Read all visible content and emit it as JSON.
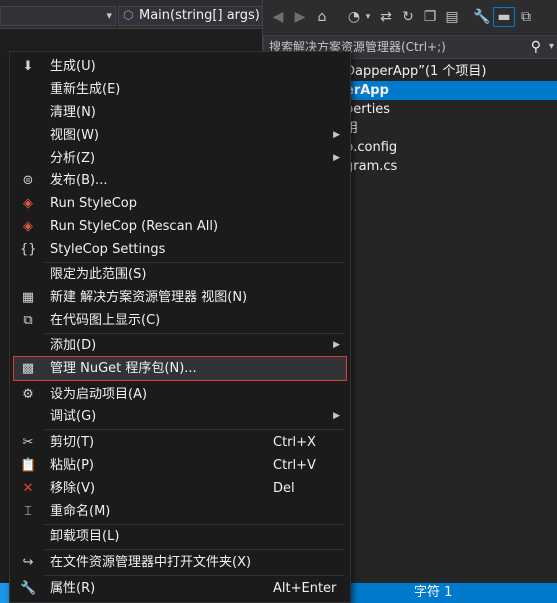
{
  "editor": {
    "method_label": "Main(string[] args)"
  },
  "solution_explorer": {
    "search_placeholder": "搜索解决方案资源管理器(Ctrl+;)",
    "tree": [
      "DapperApp”(1 个项目)",
      "erApp",
      "perties",
      "用",
      "p.config",
      "gram.cs"
    ]
  },
  "status": {
    "char": "字符 1"
  },
  "menu": {
    "items": [
      {
        "label": "生成(U)",
        "icon": "build-icon"
      },
      {
        "label": "重新生成(E)",
        "icon": ""
      },
      {
        "label": "清理(N)",
        "icon": ""
      },
      {
        "label": "视图(W)",
        "icon": "",
        "submenu": true
      },
      {
        "label": "分析(Z)",
        "icon": "",
        "submenu": true
      },
      {
        "label": "发布(B)...",
        "icon": "publish-icon"
      },
      {
        "label": "Run StyleCop",
        "icon": "stylecop-icon"
      },
      {
        "label": "Run StyleCop (Rescan All)",
        "icon": "stylecop-icon"
      },
      {
        "label": "StyleCop Settings",
        "icon": "braces-icon"
      },
      {
        "label": "限定为此范围(S)",
        "icon": ""
      },
      {
        "label": "新建 解决方案资源管理器 视图(N)",
        "icon": "new-view-icon"
      },
      {
        "label": "在代码图上显示(C)",
        "icon": "code-map-icon"
      },
      {
        "label": "添加(D)",
        "icon": "",
        "submenu": true
      },
      {
        "label": "管理 NuGet 程序包(N)...",
        "icon": "nuget-icon"
      },
      {
        "label": "设为启动项目(A)",
        "icon": "gear-icon"
      },
      {
        "label": "调试(G)",
        "icon": "",
        "submenu": true
      },
      {
        "label": "剪切(T)",
        "icon": "cut-icon",
        "shortcut": "Ctrl+X"
      },
      {
        "label": "粘贴(P)",
        "icon": "paste-icon",
        "shortcut": "Ctrl+V"
      },
      {
        "label": "移除(V)",
        "icon": "remove-icon",
        "shortcut": "Del"
      },
      {
        "label": "重命名(M)",
        "icon": "rename-icon"
      },
      {
        "label": "卸载项目(L)",
        "icon": ""
      },
      {
        "label": "在文件资源管理器中打开文件夹(X)",
        "icon": "open-folder-icon"
      },
      {
        "label": "属性(R)",
        "icon": "wrench-icon",
        "shortcut": "Alt+Enter"
      }
    ]
  }
}
